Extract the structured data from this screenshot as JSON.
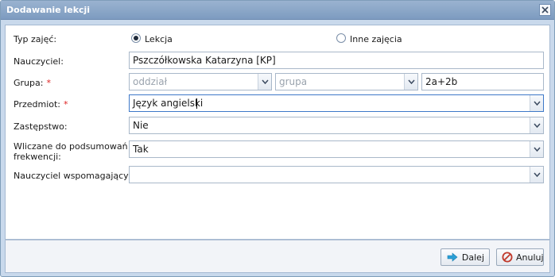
{
  "dialog": {
    "title": "Dodawanie lekcji",
    "close_label": "×"
  },
  "form": {
    "lesson_type": {
      "label": "Typ zajęć:",
      "options": [
        {
          "label": "Lekcja",
          "selected": true
        },
        {
          "label": "Inne zajęcia",
          "selected": false
        }
      ]
    },
    "teacher": {
      "label": "Nauczyciel:",
      "value": "Pszczółkowska Katarzyna [KP]"
    },
    "group": {
      "label": "Grupa:",
      "required_mark": "*",
      "division_placeholder": "oddział",
      "group_placeholder": "grupa",
      "value": "2a+2b"
    },
    "subject": {
      "label": "Przedmiot:",
      "required_mark": "*",
      "value": "Język angielski"
    },
    "substitution": {
      "label": "Zastępstwo:",
      "value": "Nie"
    },
    "attendance": {
      "label_line1": "Wliczane do podsumowań",
      "label_line2": "frekwencji:",
      "value": "Tak"
    },
    "assistant_teacher": {
      "label": "Nauczyciel wspomagający:",
      "value": ""
    }
  },
  "footer": {
    "next_label": "Dalej",
    "cancel_label": "Anuluj"
  },
  "colors": {
    "title_bar": "#7d9bc0",
    "required": "#dd2222",
    "next_icon": "#2a9fd6",
    "cancel_icon": "#c0392b"
  }
}
